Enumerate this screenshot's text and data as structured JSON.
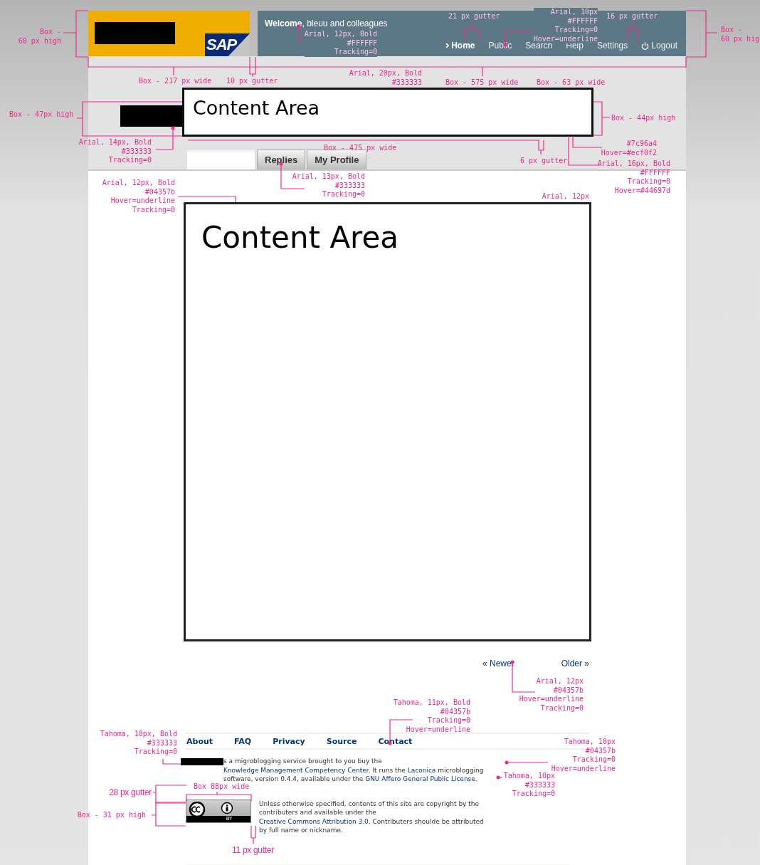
{
  "header": {
    "logo": {
      "text": "SAP"
    },
    "welcome": {
      "bold": "Welcome",
      "rest": ", bleuu and colleagues"
    },
    "nav": [
      {
        "label": "Home",
        "selected": true
      },
      {
        "label": "Public",
        "selected": false
      },
      {
        "label": "Search",
        "selected": false
      },
      {
        "label": "Help",
        "selected": false
      },
      {
        "label": "Settings",
        "selected": false
      },
      {
        "label": "Logout",
        "selected": false,
        "kind": "logout"
      }
    ]
  },
  "status": {
    "placeholder_box": "Content Area"
  },
  "tabs": [
    {
      "selected": true
    },
    {
      "label": "Replies",
      "selected": false
    },
    {
      "label": "My Profile",
      "selected": false
    }
  ],
  "content": {
    "placeholder_box": "Content Area"
  },
  "pagination": [
    "« Newer",
    "Older »"
  ],
  "footer": {
    "nav": [
      "About",
      "FAQ",
      "Privacy",
      "Source",
      "Contact"
    ],
    "about": [
      {
        "text": "s a migroblogging service brought to you buy the "
      },
      {
        "text": "Knowledge Management Competency Center",
        "link": true
      },
      {
        "text": ". It runs the "
      },
      {
        "text": "Laconica",
        "link": true
      },
      {
        "text": " microblogging software, version 0.4.4, available under the "
      },
      {
        "text": "GNU Affero General Public License",
        "link": true
      },
      {
        "text": "."
      }
    ],
    "badge": {
      "label": "BY"
    },
    "license": [
      {
        "text": "Unless otherwise specified, contents of this site are copyright by the contributers and available under the "
      },
      {
        "text": "Creative Commons Attribution 3.0",
        "link": true
      },
      {
        "text": ". Contributers shoulde be attributed by full name or nickname."
      }
    ]
  },
  "annotations": [
    {
      "kind": "mono",
      "lines": [
        "Box -",
        "60 px high"
      ]
    },
    {
      "kind": "mono",
      "lines": [
        "Arial, 12px, Bold",
        "#FFFFFF",
        "Tracking=0"
      ]
    },
    {
      "kind": "mono",
      "lines": [
        "21 px gutter"
      ]
    },
    {
      "kind": "mono",
      "lines": [
        "Arial, 10px",
        "#FFFFFF",
        "Tracking=0",
        "Hover=underline"
      ]
    },
    {
      "kind": "mono",
      "lines": [
        "16 px gutter"
      ]
    },
    {
      "kind": "mono",
      "lines": [
        "Box -",
        "60 px hig"
      ]
    },
    {
      "kind": "mono",
      "lines": [
        "Box - 217 px wide"
      ]
    },
    {
      "kind": "mono",
      "lines": [
        "10 px gutter"
      ]
    },
    {
      "kind": "mono",
      "lines": [
        "Arial, 20px, Bold",
        "#333333"
      ]
    },
    {
      "kind": "mono",
      "lines": [
        "Box - 575 px wide"
      ]
    },
    {
      "kind": "mono",
      "lines": [
        "Box - 63 px wide"
      ]
    },
    {
      "kind": "mono",
      "lines": [
        "Box - 47px high"
      ]
    },
    {
      "kind": "mono",
      "lines": [
        "Box - 44px high"
      ]
    },
    {
      "kind": "mono",
      "lines": [
        "Arial, 14px, Bold",
        "#333333",
        "Tracking=0"
      ]
    },
    {
      "kind": "mono",
      "lines": [
        "Box - 475 px wide"
      ]
    },
    {
      "kind": "mono",
      "lines": [
        "#7c96a4",
        "Hover=#ecf0f2"
      ]
    },
    {
      "kind": "mono",
      "lines": [
        "6 px gutter"
      ]
    },
    {
      "kind": "mono",
      "lines": [
        "Arial, 16px, Bold",
        "#FFFFFF",
        "Tracking=0",
        "Hover=#44697d"
      ]
    },
    {
      "kind": "mono",
      "lines": [
        "Arial, 12px, Bold",
        "#04357b",
        "Hover=underline",
        "Tracking=0"
      ]
    },
    {
      "kind": "mono",
      "lines": [
        "Arial, 13px, Bold",
        "#333333",
        "Tracking=0"
      ]
    },
    {
      "kind": "mono",
      "lines": [
        "Arial, 12px"
      ]
    },
    {
      "kind": "mono",
      "lines": [
        "Arial, 12px",
        "#04357b",
        "Hover=underline",
        "Tracking=0"
      ]
    },
    {
      "kind": "mono",
      "lines": [
        "Tahoma, 11px, Bold",
        "#04357b",
        "Tracking=0",
        "Hover=underline"
      ]
    },
    {
      "kind": "mono",
      "lines": [
        "Tahoma, 10px, Bold",
        "#333333",
        "Tracking=0"
      ]
    },
    {
      "kind": "mono",
      "lines": [
        "Tahoma, 10px",
        "#04357b",
        "Tracking=0",
        "Hover=underline"
      ]
    },
    {
      "kind": "sans",
      "lines": [
        "28 px gutter"
      ]
    },
    {
      "kind": "mono",
      "lines": [
        "Box 88px wide"
      ]
    },
    {
      "kind": "mono",
      "lines": [
        "Tahoma, 10px",
        "#333333",
        "Tracking=0"
      ]
    },
    {
      "kind": "mono",
      "lines": [
        "Box - 31 px high"
      ]
    },
    {
      "kind": "sans",
      "lines": [
        "11 px gutter"
      ]
    }
  ]
}
